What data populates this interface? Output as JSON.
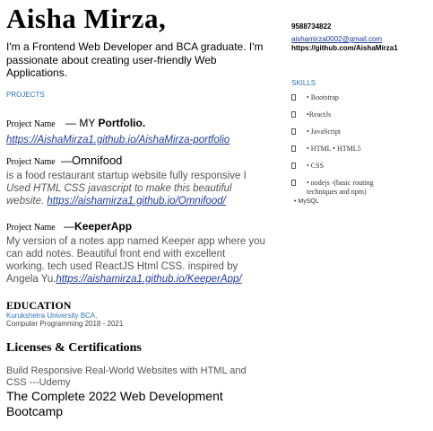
{
  "header": {
    "name": "Aisha Mirza,",
    "intro": "I'm a Frontend Web Developer and BCA graduate. I'm passionate about creating user-friendly Web Applications."
  },
  "projects": {
    "heading": "PROJECTS",
    "label": "Project Name",
    "items": [
      {
        "separator": "— MY ",
        "title": "Portfolio.",
        "link": "https://AishaMirza1.github.io/AishaMirza-portfolio",
        "description": "",
        "description_italic": ""
      },
      {
        "separator": "—",
        "title": "Omnifood",
        "link": "https://aishamirza1.github.io/Omnifood/",
        "description": "is a food restaurant startup website fully responsive I",
        "description_italic": "Used HTML CSS javascript to make this beautiful website."
      },
      {
        "separator": "—",
        "title": "KeeperApp",
        "link": "https://aishamirza1.github.io/KeeperApp/",
        "description": "My version of a notes app named Keeper app where you can add notes. Beautiful front end with excellent working. tech used ReactJS Html CSS. inspired by Angela Yu.",
        "description_italic": ""
      }
    ]
  },
  "education": {
    "heading": "EDUCATION",
    "institution": "Kurukshetra University BCA,",
    "detail": "Computer Programming 2018 - 2021"
  },
  "licenses": {
    "heading": "Licenses & Certifications",
    "items": [
      "Build Responsive Real-World Websites with HTML and CSS ---Udemy",
      "The Complete 2022 Web Development Bootcamp"
    ]
  },
  "contact": {
    "phone": "9588734822",
    "email": "aishamirza0002@gmail.com",
    "github": "https://github.com/AishaMirza1"
  },
  "skills": {
    "heading": "SKILLS",
    "items": [
      "•  Bootstrap",
      "•ReactJs",
      "•  JavaScript",
      "•  HTML   •  HTML5",
      "•  CSS",
      "•  nodejs -(basic routing techniques and npm)"
    ],
    "extra": "• MySQL"
  }
}
